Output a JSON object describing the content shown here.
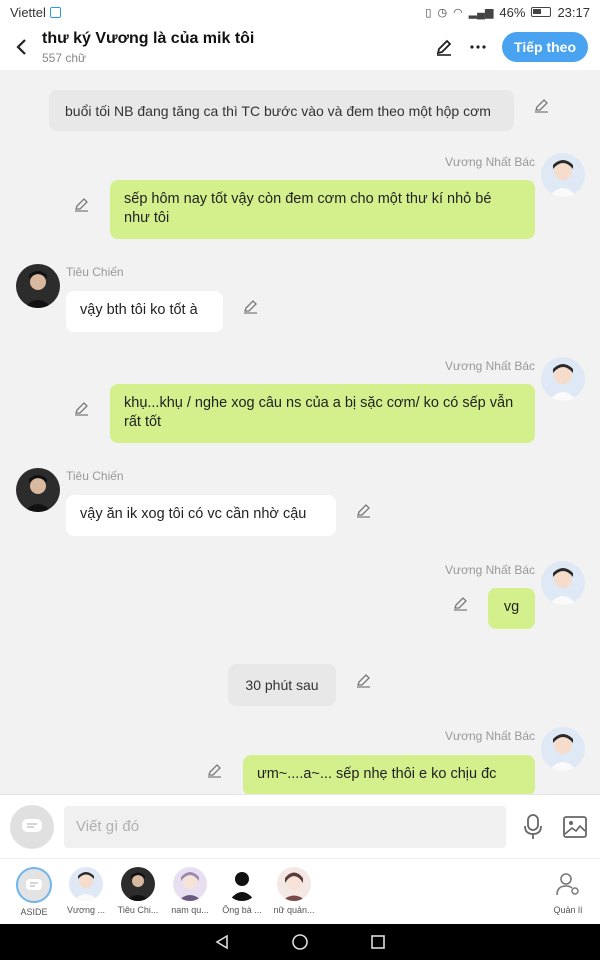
{
  "status": {
    "carrier": "Viettel",
    "battery": "46%",
    "time": "23:17"
  },
  "header": {
    "title": "thư ký Vương là của mik tôi",
    "word_count": "557 chữ",
    "next_label": "Tiếp theo"
  },
  "messages": [
    {
      "kind": "narration",
      "text": "buổi tối NB đang tăng ca thì TC bước vào và đem theo một hộp cơm"
    },
    {
      "kind": "right",
      "sender": "Vương Nhất Bác",
      "text": "sếp hôm nay tốt vậy còn đem cơm cho một thư kí nhỏ bé như tôi"
    },
    {
      "kind": "left",
      "sender": "Tiêu Chiến",
      "text": "vậy bth tôi ko tốt à"
    },
    {
      "kind": "right",
      "sender": "Vương Nhất Bác",
      "text": "khụ...khụ / nghe xog câu ns của a bị sặc cơm/ ko có sếp vẫn rất tốt"
    },
    {
      "kind": "left",
      "sender": "Tiêu Chiến",
      "text": "vậy ăn ik xog tôi có vc cần nhờ cậu"
    },
    {
      "kind": "right",
      "sender": "Vương Nhất Bác",
      "text": "vg"
    },
    {
      "kind": "narration",
      "text": "30 phút sau"
    },
    {
      "kind": "right",
      "sender": "Vương Nhất Bác",
      "text": "ưm~....a~... sếp nhẹ thôi e ko chịu đc"
    }
  ],
  "input": {
    "placeholder": "Viết gì đó"
  },
  "characters": [
    {
      "label": "ASIDE"
    },
    {
      "label": "Vương ..."
    },
    {
      "label": "Tiêu Chi..."
    },
    {
      "label": "nam qu..."
    },
    {
      "label": "Ông bà ..."
    },
    {
      "label": "nữ quản..."
    },
    {
      "label": "Quản lí"
    }
  ],
  "colors": {
    "accent": "#4aa3f0",
    "bubble_self": "#d3f08c",
    "bubble_other": "#ffffff",
    "narration": "#e8e8e8"
  },
  "icons": [
    "back-icon",
    "pencil-icon",
    "more-icon",
    "edit-icon",
    "microphone-icon",
    "image-icon",
    "chat-bubble-icon",
    "manage-user-icon",
    "nav-back-icon",
    "nav-home-icon",
    "nav-recent-icon"
  ]
}
